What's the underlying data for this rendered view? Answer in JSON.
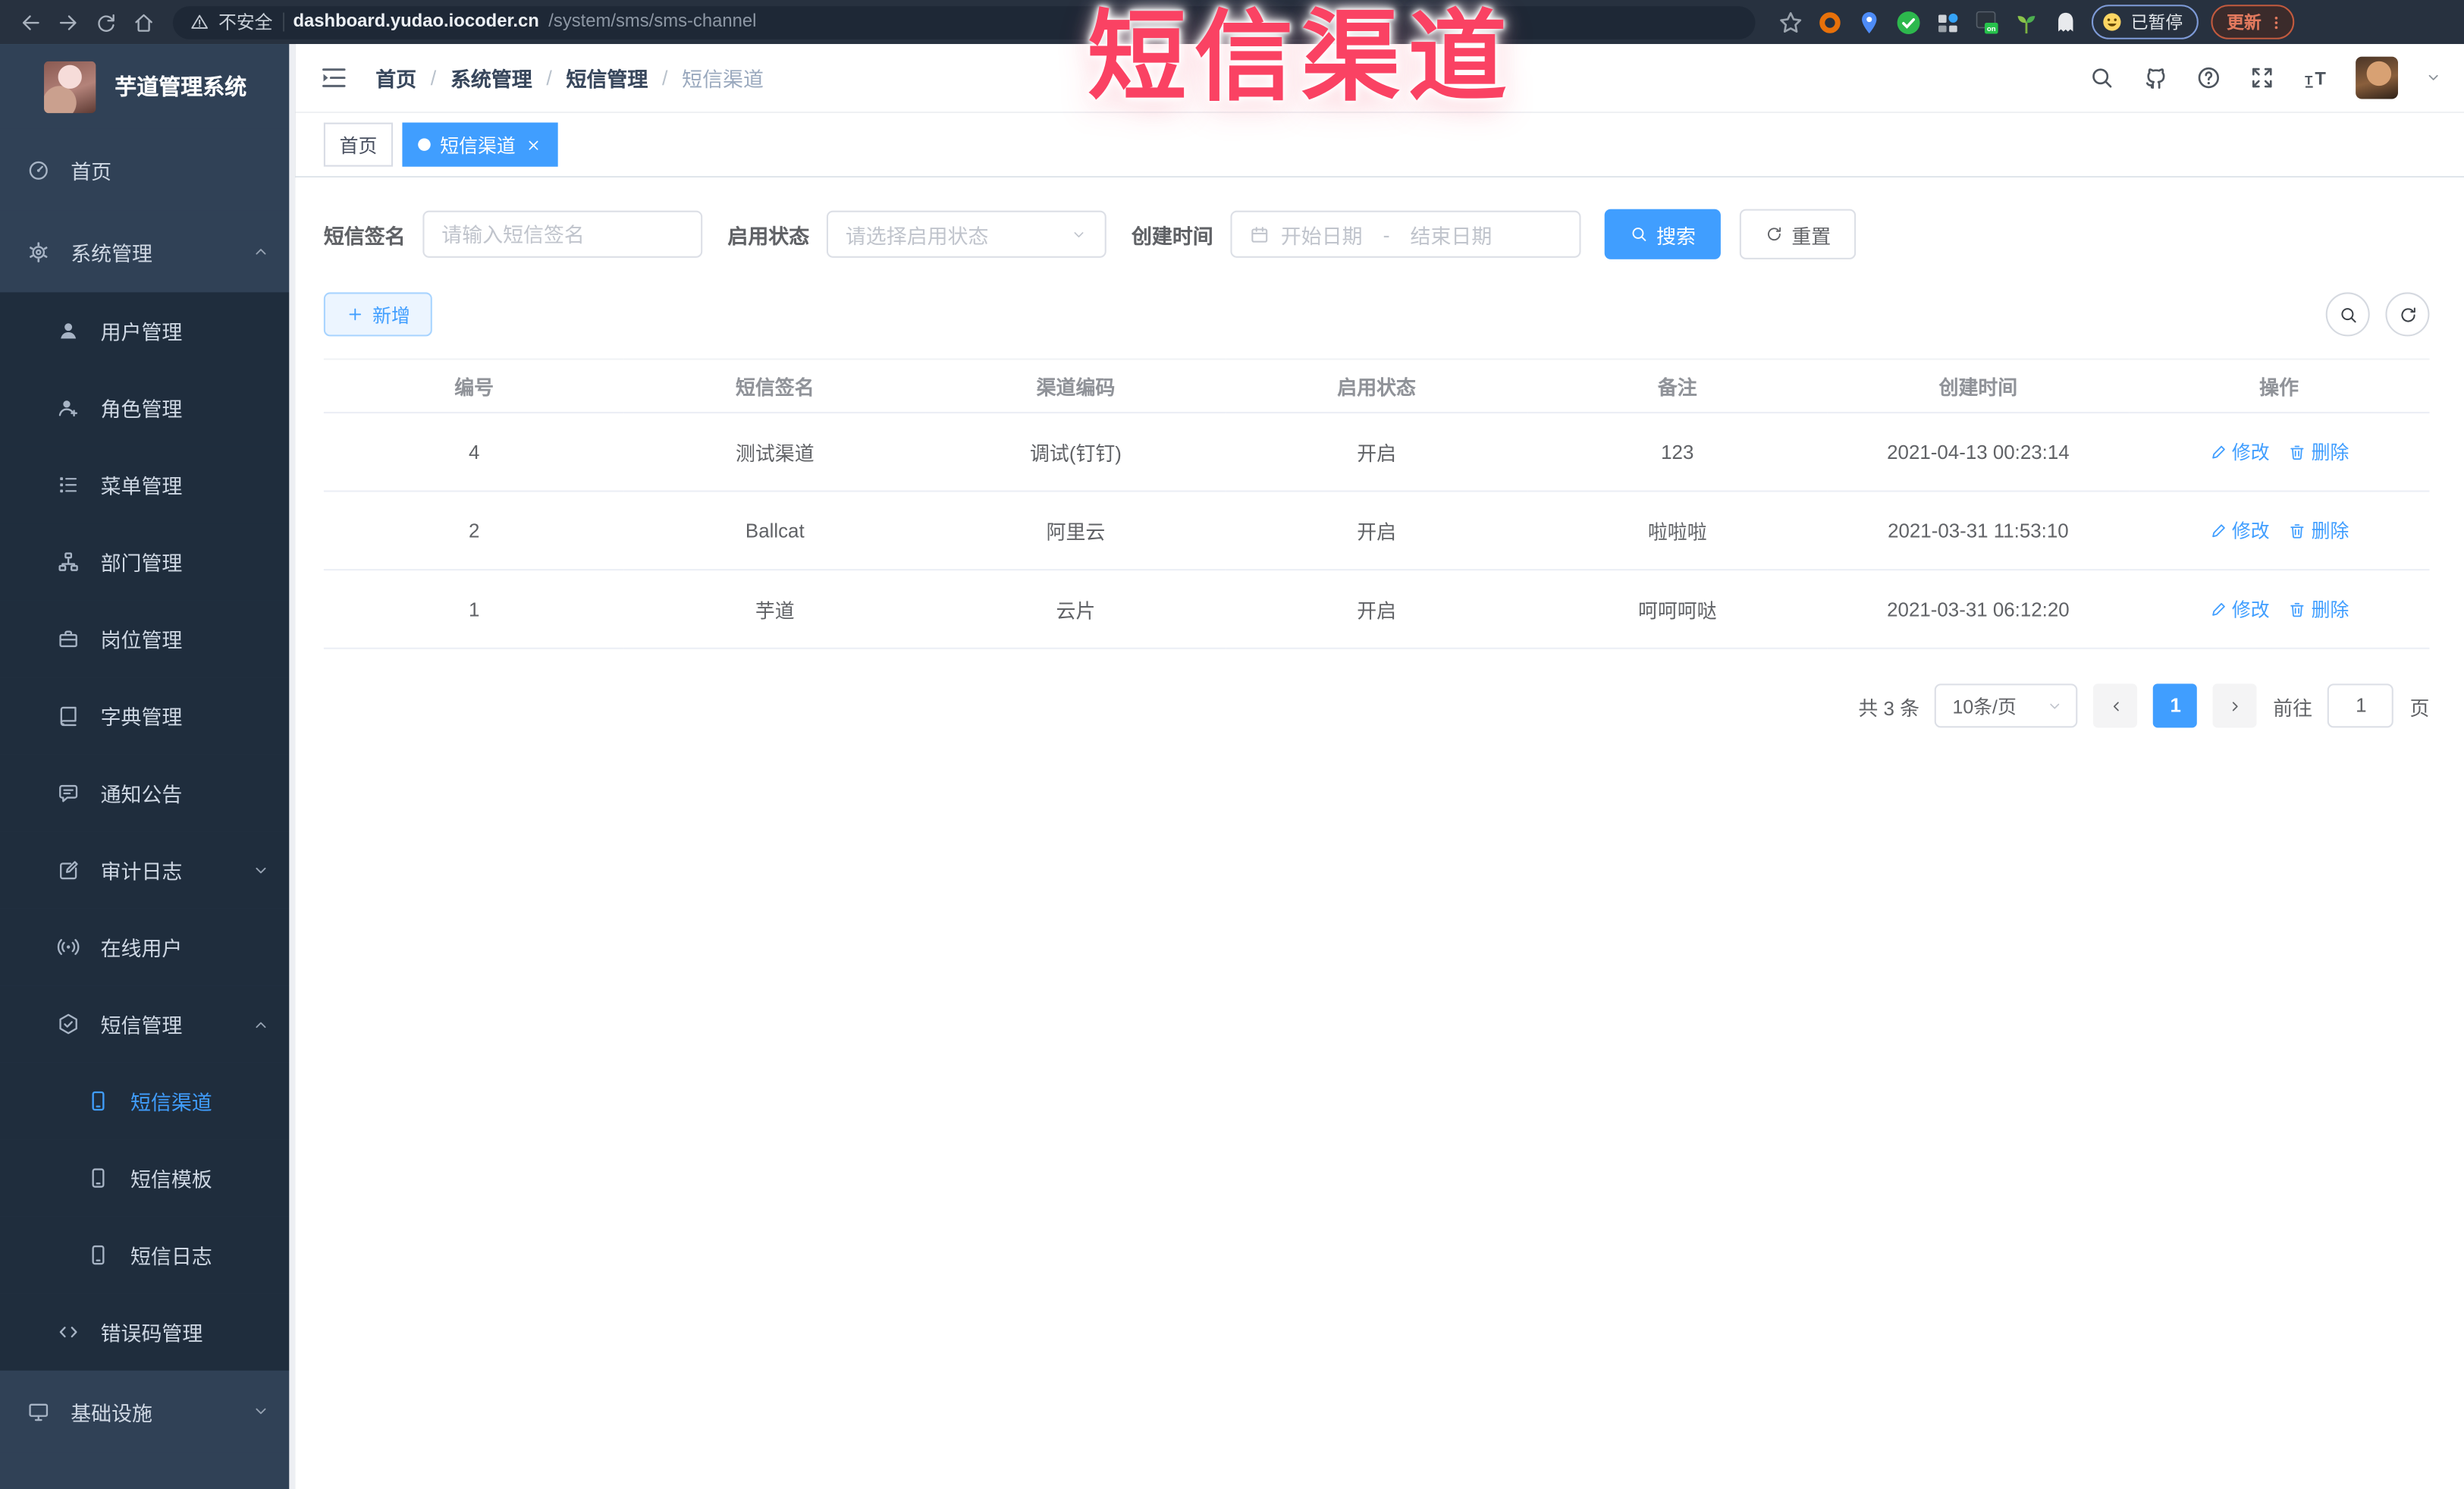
{
  "browser": {
    "security_label": "不安全",
    "url_host": "dashboard.yudao.iocoder.cn",
    "url_path": "/system/sms/sms-channel",
    "paused_label": "已暂停",
    "update_label": "更新"
  },
  "overlay_title": "短信渠道",
  "sidebar": {
    "app_title": "芋道管理系统",
    "menu": [
      {
        "name": "home",
        "label": "首页",
        "icon": "dashboard",
        "level": 1
      },
      {
        "name": "system",
        "label": "系统管理",
        "icon": "gear",
        "level": 1,
        "caret": "up"
      },
      {
        "name": "users",
        "label": "用户管理",
        "icon": "user",
        "level": 2
      },
      {
        "name": "roles",
        "label": "角色管理",
        "icon": "role",
        "level": 2
      },
      {
        "name": "menus",
        "label": "菜单管理",
        "icon": "menu",
        "level": 2
      },
      {
        "name": "depts",
        "label": "部门管理",
        "icon": "tree",
        "level": 2
      },
      {
        "name": "posts",
        "label": "岗位管理",
        "icon": "post",
        "level": 2
      },
      {
        "name": "dict",
        "label": "字典管理",
        "icon": "dict",
        "level": 2
      },
      {
        "name": "notice",
        "label": "通知公告",
        "icon": "notice",
        "level": 2
      },
      {
        "name": "audit-log",
        "label": "审计日志",
        "icon": "log",
        "level": 2,
        "caret": "down"
      },
      {
        "name": "online-users",
        "label": "在线用户",
        "icon": "online",
        "level": 2
      },
      {
        "name": "sms",
        "label": "短信管理",
        "icon": "sms",
        "level": 2,
        "caret": "up"
      },
      {
        "name": "sms-channel",
        "label": "短信渠道",
        "icon": "mobile",
        "level": 3,
        "active": true
      },
      {
        "name": "sms-template",
        "label": "短信模板",
        "icon": "mobile",
        "level": 3
      },
      {
        "name": "sms-log",
        "label": "短信日志",
        "icon": "mobile",
        "level": 3
      },
      {
        "name": "error-code",
        "label": "错误码管理",
        "icon": "code",
        "level": 2
      },
      {
        "name": "infra",
        "label": "基础设施",
        "icon": "monitor",
        "level": 1,
        "caret": "down"
      }
    ]
  },
  "header": {
    "breadcrumb": [
      "首页",
      "系统管理",
      "短信管理",
      "短信渠道"
    ],
    "breadcrumb_separator": "/"
  },
  "tabs": [
    {
      "name": "home",
      "label": "首页",
      "active": false
    },
    {
      "name": "sms-channel",
      "label": "短信渠道",
      "active": true
    }
  ],
  "filters": {
    "sign_label": "短信签名",
    "sign_placeholder": "请输入短信签名",
    "status_label": "启用状态",
    "status_placeholder": "请选择启用状态",
    "time_label": "创建时间",
    "date_start_placeholder": "开始日期",
    "date_separator": "-",
    "date_end_placeholder": "结束日期",
    "search_label": "搜索",
    "reset_label": "重置"
  },
  "toolbar": {
    "add_label": "新增"
  },
  "table": {
    "headers": [
      "编号",
      "短信签名",
      "渠道编码",
      "启用状态",
      "备注",
      "创建时间",
      "操作"
    ],
    "rows": [
      {
        "id": "4",
        "sign": "测试渠道",
        "code": "调试(钉钉)",
        "status": "开启",
        "remark": "123",
        "created": "2021-04-13 00:23:14"
      },
      {
        "id": "2",
        "sign": "Ballcat",
        "code": "阿里云",
        "status": "开启",
        "remark": "啦啦啦",
        "created": "2021-03-31 11:53:10"
      },
      {
        "id": "1",
        "sign": "芋道",
        "code": "云片",
        "status": "开启",
        "remark": "呵呵呵哒",
        "created": "2021-03-31 06:12:20"
      }
    ],
    "actions": {
      "edit": "修改",
      "delete": "删除"
    }
  },
  "pagination": {
    "total": "共 3 条",
    "page_size": "10条/页",
    "current_page": "1",
    "goto_label": "前往",
    "goto_value": "1",
    "unit_label": "页"
  }
}
